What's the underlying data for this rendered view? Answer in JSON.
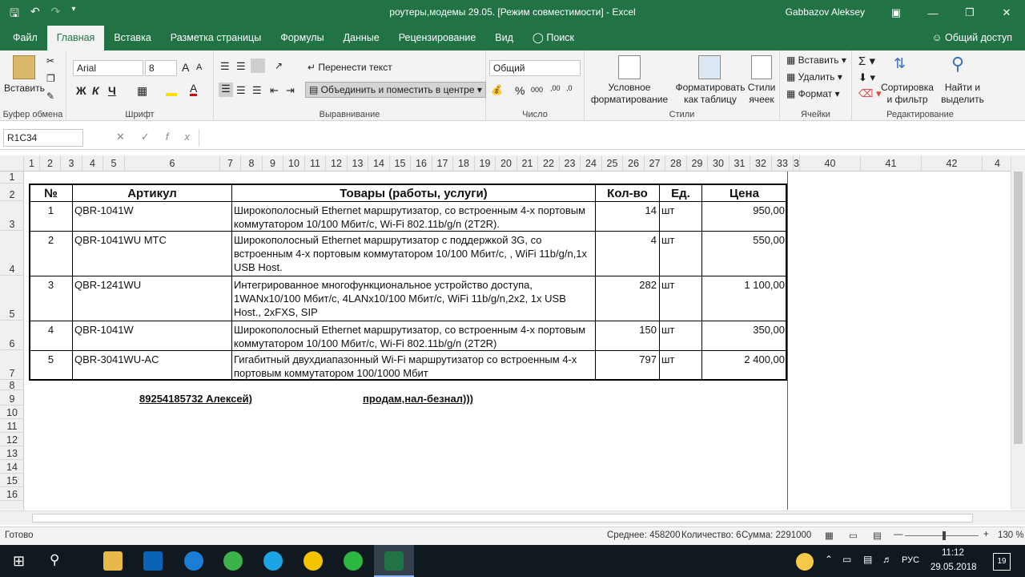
{
  "window": {
    "title": "роутеры,модемы 29.05.  [Режим совместимости]  -  Excel",
    "user": "Gabbazov Aleksey"
  },
  "ribbon_tabs": [
    "Файл",
    "Главная",
    "Вставка",
    "Разметка страницы",
    "Формулы",
    "Данные",
    "Рецензирование",
    "Вид",
    "Поиск"
  ],
  "share_label": "Общий доступ",
  "ribbon": {
    "clipboard": {
      "paste": "Вставить",
      "group": "Буфер обмена"
    },
    "font": {
      "name": "Arial",
      "size": "8",
      "group": "Шрифт",
      "bold": "Ж",
      "italic": "К",
      "underline": "Ч"
    },
    "alignment": {
      "wrap": "Перенести текст",
      "merge": "Объединить и поместить в центре",
      "group": "Выравнивание"
    },
    "number": {
      "format": "Общий",
      "group": "Число"
    },
    "styles": {
      "conditional": "Условное форматирование",
      "astable": "Форматировать как таблицу",
      "cellstyles": "Стили ячеек",
      "group": "Стили"
    },
    "cells": {
      "insert": "Вставить",
      "delete": "Удалить",
      "format": "Формат",
      "group": "Ячейки"
    },
    "editing": {
      "sort": "Сортировка и фильтр",
      "find": "Найти и выделить",
      "group": "Редактирование"
    }
  },
  "formula_bar": {
    "name_box": "R1C34",
    "formula": ""
  },
  "columns": [
    "1",
    "2",
    "3",
    "4",
    "5",
    "6",
    "7",
    "8",
    "9",
    "10",
    "11",
    "12",
    "13",
    "14",
    "15",
    "16",
    "17",
    "18",
    "19",
    "20",
    "21",
    "22",
    "23",
    "24",
    "25",
    "26",
    "27",
    "28",
    "29",
    "30",
    "31",
    "32",
    "33",
    "3",
    "40",
    "41",
    "42",
    "4"
  ],
  "rows": [
    "1",
    "2",
    "3",
    "4",
    "5",
    "6",
    "7",
    "8",
    "9",
    "10",
    "11",
    "12",
    "13",
    "14",
    "15",
    "16"
  ],
  "table": {
    "headers": {
      "num": "№",
      "article": "Артикул",
      "goods": "Товары (работы, услуги)",
      "qty": "Кол-во",
      "unit": "Ед.",
      "price": "Цена"
    },
    "rows": [
      {
        "num": "1",
        "article": "QBR-1041W",
        "goods": "Широкополосный Ethernet маршрутизатор, со встроенным 4-х портовым коммутатором 10/100 Мбит/с, Wi-Fi 802.11b/g/n (2T2R).",
        "qty": "14",
        "unit": "шт",
        "price": "950,00"
      },
      {
        "num": "2",
        "article": "QBR-1041WU МТС",
        "goods": "Широкополосный Ethernet маршрутизатор с поддержкой 3G, со встроенным 4-х портовым коммутатором 10/100 Мбит/с, , WiFi 11b/g/n,1x USB Host.",
        "qty": "4",
        "unit": "шт",
        "price": "550,00"
      },
      {
        "num": "3",
        "article": "QBR-1241WU",
        "goods": "Интегрированное многофункциональное устройство доступа, 1WANx10/100 Мбит/с, 4LANx10/100 Мбит/с, WiFi 11b/g/n,2x2, 1x USB Host., 2xFXS, SIP",
        "qty": "282",
        "unit": "шт",
        "price": "1 100,00"
      },
      {
        "num": "4",
        "article": "QBR-1041W",
        "goods": "Широкополосный Ethernet маршрутизатор, со встроенным 4-х портовым коммутатором 10/100 Мбит/с, Wi-Fi 802.11b/g/n (2T2R)",
        "qty": "150",
        "unit": "шт",
        "price": "350,00"
      },
      {
        "num": "5",
        "article": "QBR-3041WU-AC",
        "goods": "Гигабитный двухдиапазонный Wi-Fi маршрутизатор со встроенным 4-х портовым коммутатором 100/1000 Мбит",
        "qty": "797",
        "unit": "шт",
        "price": "2 400,00"
      }
    ]
  },
  "notes": {
    "contact": "89254185732 Алексей)",
    "sale": "продам,нал-безнал)))"
  },
  "status": {
    "ready": "Готово",
    "avg": "Среднее: 458200",
    "count": "Количество: 6",
    "sum": "Сумма: 2291000",
    "zoom": "130 %"
  },
  "taskbar": {
    "lang": "РУС",
    "time": "11:12",
    "date": "29.05.2018",
    "notif": "19"
  },
  "colors": {
    "brand": "#217346",
    "taskbar": "#101820"
  }
}
